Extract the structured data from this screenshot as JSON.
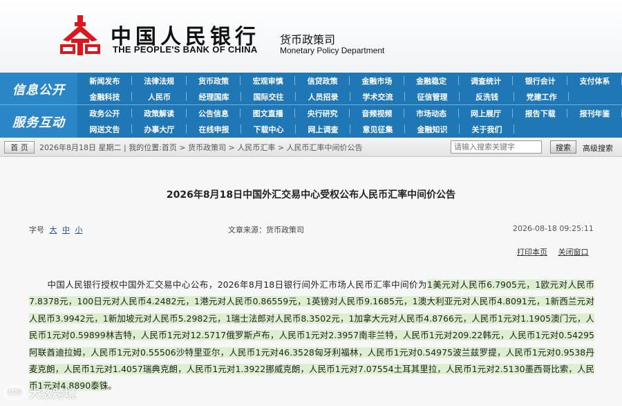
{
  "header": {
    "bank_name_cn": "中国人民银行",
    "bank_name_en": "THE PEOPLE'S BANK OF CHINA",
    "dept_cn": "货币政策司",
    "dept_en": "Monetary Policy Department",
    "logo_color": "#d8181f"
  },
  "nav": {
    "bg_color": "#1f77b6",
    "sections": [
      {
        "title": "信息公开",
        "rows": [
          [
            "新闻发布",
            "法律法规",
            "货币政策",
            "宏观审慎",
            "信贷政策",
            "金融市场",
            "金融稳定",
            "调查统计",
            "银行会计",
            "支付体系"
          ],
          [
            "金融科技",
            "人民币",
            "经理国库",
            "国际交往",
            "人员招录",
            "学术交流",
            "征信管理",
            "反洗钱",
            "党建工作"
          ]
        ]
      },
      {
        "title": "服务互动",
        "rows": [
          [
            "政务公开",
            "政策解读",
            "公告信息",
            "图文直播",
            "央行研究",
            "音频视频",
            "市场动态",
            "网上展厅",
            "报告下载",
            "报刊年鉴"
          ],
          [
            "网送文告",
            "办事大厅",
            "在线申报",
            "下载中心",
            "网上调查",
            "意见征集",
            "金融知识",
            "关于我们"
          ]
        ]
      }
    ]
  },
  "crumbbar": {
    "home_label": "首 页",
    "date_text": "2026年8月18日 星期二",
    "location_text": "我的位置:首页 > 货币政策司 > 人民币汇率 > 人民币汇率中间价公告",
    "search_placeholder": "请输入搜索关键字",
    "search_button": "搜索",
    "advanced_search": "高级搜索"
  },
  "article": {
    "title": "2026年8月18日中国外汇交易中心受权公布人民币汇率中间价公告",
    "size_label": "字号",
    "size_large": "大",
    "size_medium": "中",
    "size_small": "小",
    "source_text": "文章来源：货币政策司",
    "datetime": "2026-08-18 09:25:11",
    "print_label": "打印本页",
    "close_label": "关闭窗口",
    "body_intro": "中国人民银行授权中国外汇交易中心公布，2026年8月18日银行间外汇市场人民币汇率中间价为",
    "body_rates": "1美元对人民币6.7905元，1欧元对人民币7.8378元，100日元对人民币4.2482元，1港元对人民币0.86559元，1英镑对人民币9.1685元，1澳大利亚元对人民币4.8091元，1新西兰元对人民币3.9942元，1新加坡元对人民币5.2982元，1瑞士法郎对人民币8.3502元，1加拿大元对人民币4.8766元，人民币1元对1.1905澳门元，人民币1元对0.59899林吉特，人民币1元对12.5717俄罗斯卢布，人民币1元对2.3957南非兰特，人民币1元对209.22韩元，人民币1元对0.54295阿联酋迪拉姆，人民币1元对0.55506沙特里亚尔，人民币1元对46.3528匈牙利福林，人民币1元对0.54975波兰兹罗提，人民币1元对0.9538丹麦克朗，人民币1元对1.4057瑞典克朗，人民币1元对1.3922挪威克朗，人民币1元对7.07554土耳其里拉，人民币1元对2.5130墨西哥比索，人民币1元对4.8890泰铢",
    "body_end": "。"
  },
  "watermark": {
    "logo_text": "100",
    "text": "大数跨境"
  }
}
